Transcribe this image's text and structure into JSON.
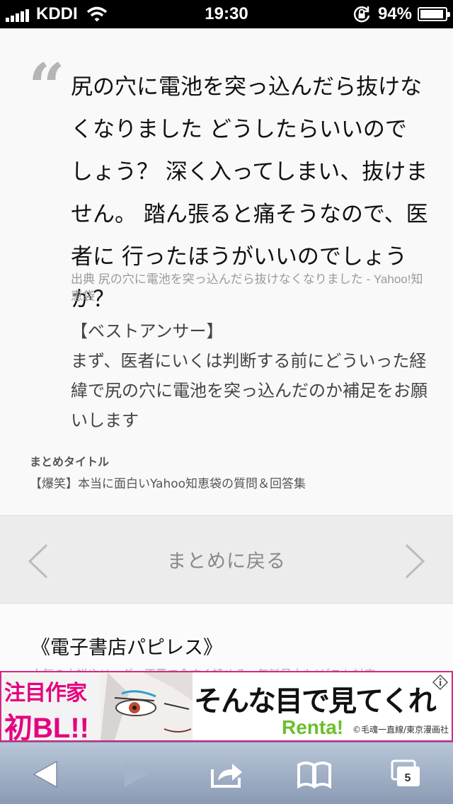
{
  "status_bar": {
    "carrier": "KDDI",
    "time": "19:30",
    "battery": "94%",
    "battery_level": 0.94
  },
  "quote": {
    "text": "尻の穴に電池を突っ込んだら抜けなくなりました どうしたらいいのでしょう？ 深く入ってしまい、抜けません。 踏ん張ると痛そうなので、医者に 行ったほうがいいのでしょうか？",
    "source": "出典  尻の穴に電池を突っ込んだら抜けなくなりました - Yahoo!知恵袋",
    "answer_heading": "【ベストアンサー】",
    "answer_body": "まず、医者にいくは判断する前にどういった経緯で尻の穴に電池を突っ込んだのか補足をお願いします"
  },
  "summary": {
    "label": "まとめタイトル",
    "title": "【爆笑】本当に面白いYahoo知恵袋の質問＆回答集"
  },
  "back_nav": {
    "label": "まとめに戻る"
  },
  "store": {
    "title": "《電子書店パピレス》",
    "subtitle": "人気の小説やリーダー不要で今すぐ読める、無料見本も(ゲスト対応"
  },
  "ad": {
    "tag_line1": "注目作家",
    "tag_line2": "初BL!!",
    "headline": "そんな目で見てくれ",
    "brand": "Renta!",
    "credit": "©毛魂一直線/東京漫画社"
  },
  "toolbar": {
    "tab_count": "5"
  },
  "colors": {
    "ad_border": "#d1298a",
    "ad_accent": "#e6007e",
    "brand_green": "#6bbf2a"
  }
}
